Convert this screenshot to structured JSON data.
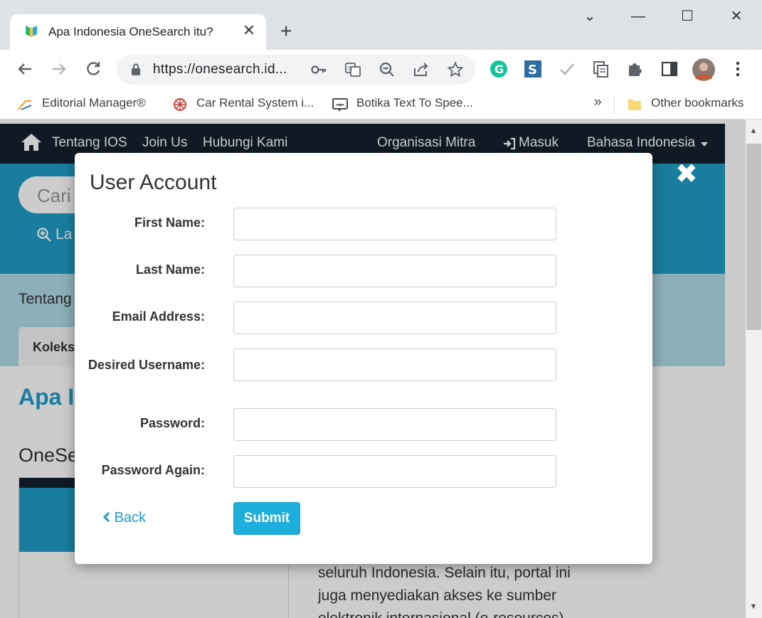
{
  "browser": {
    "tab_title": "Apa Indonesia OneSearch itu?",
    "tab_close": "✕",
    "new_tab": "+",
    "url": "https://onesearch.id...",
    "window_controls": {
      "dropdown": "⌄",
      "minimize": "—",
      "maximize": "☐",
      "close": "✕"
    },
    "bookmarks": [
      {
        "label": "Editorial Manager®",
        "icon": "editorial-manager-icon"
      },
      {
        "label": "Car Rental System i...",
        "icon": "car-rental-icon"
      },
      {
        "label": "Botika Text To Spee...",
        "icon": "botika-icon"
      }
    ],
    "bookmarks_overflow": "»",
    "other_bookmarks": "Other bookmarks",
    "extensions": [
      "grammarly-icon",
      "s-extension-icon",
      "check-icon",
      "reading-list-icon",
      "puzzle-icon",
      "sidepanel-icon",
      "profile-avatar",
      "kebab-menu-icon"
    ]
  },
  "site": {
    "nav": {
      "items": [
        "Tentang IOS",
        "Join Us",
        "Hubungi Kami"
      ],
      "right_items": [
        "Organisasi Mitra",
        "Masuk",
        "Bahasa Indonesia"
      ]
    },
    "search_placeholder": "Cari",
    "hero_link": "La",
    "about_label": "Tentang",
    "tab_label": "Koleks",
    "content_title": "Apa In",
    "content_subtitle": "OneSe",
    "body_text_1": "seluruh Indonesia. Selain itu, portal ini",
    "body_text_2": "juga menyediakan akses ke sumber",
    "body_text_3": "elektronik internasional (e-resources)"
  },
  "modal": {
    "title": "User Account",
    "fields": [
      {
        "label": "First Name:",
        "value": ""
      },
      {
        "label": "Last Name:",
        "value": ""
      },
      {
        "label": "Email Address:",
        "value": ""
      },
      {
        "label": "Desired Username:",
        "value": ""
      },
      {
        "label": "Password:",
        "value": ""
      },
      {
        "label": "Password Again:",
        "value": ""
      }
    ],
    "back_label": "Back",
    "submit_label": "Submit",
    "close": "✖"
  },
  "colors": {
    "accent": "#1eaedb",
    "nav_bg": "#13212e",
    "hero_bg": "#1e9dc7"
  }
}
